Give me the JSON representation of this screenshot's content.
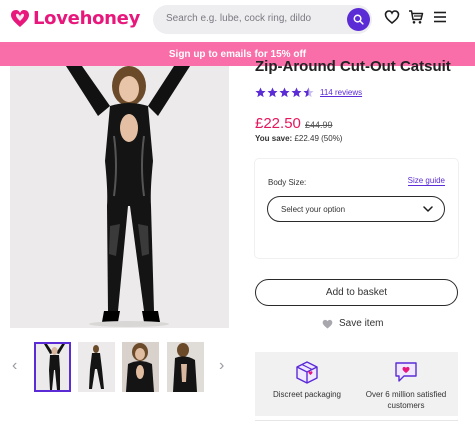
{
  "header": {
    "brand": "Lovehoney",
    "search_placeholder": "Search e.g. lube, cock ring, dildo",
    "icons": [
      "search-icon",
      "heart-icon",
      "basket-icon",
      "menu-icon"
    ]
  },
  "promo": {
    "text": "Sign up to emails for 15% off"
  },
  "product": {
    "title": "Zip-Around Cut-Out Catsuit",
    "rating": 4.5,
    "reviews": "114 reviews",
    "price": "£22.50",
    "old_price": "£44.99",
    "save_label": "You save:",
    "save_value": "£22.49 (50%)"
  },
  "size": {
    "label": "Body Size:",
    "guide": "Size guide",
    "select_text": "Select your option"
  },
  "actions": {
    "add_to_basket": "Add to basket",
    "save_item": "Save item"
  },
  "features": [
    {
      "icon": "discreet-box-icon",
      "text": "Discreet packaging"
    },
    {
      "icon": "speech-heart-icon",
      "text": "Over 6 million satisfied customers"
    }
  ],
  "gallery": {
    "thumb_count": 4,
    "active_index": 0
  },
  "colors": {
    "brand_pink": "#e8177c",
    "promo_pink": "#f96ea8",
    "accent_purple": "#5b2bd6",
    "price_red": "#e5175c"
  }
}
